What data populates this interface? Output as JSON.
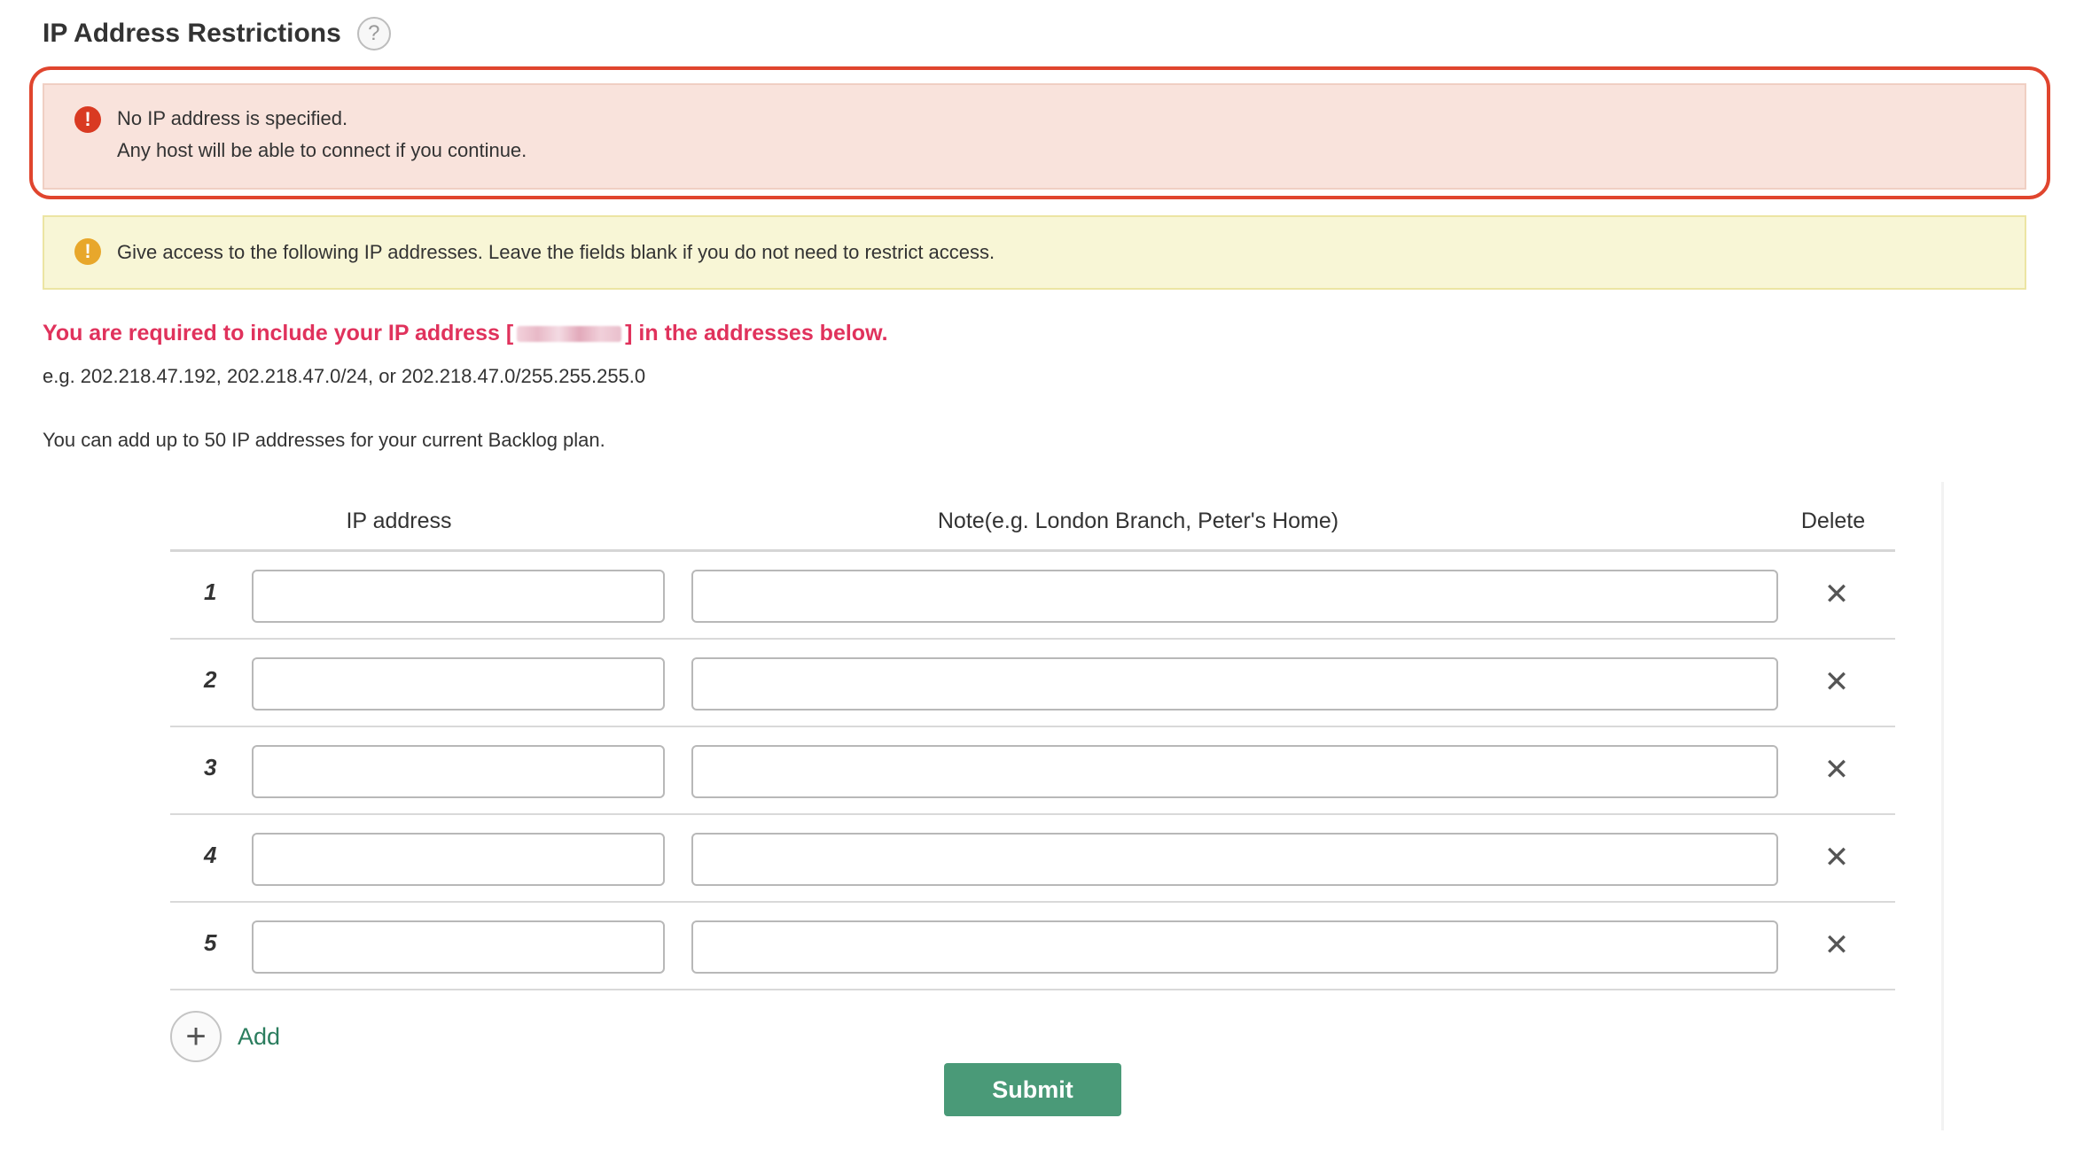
{
  "page": {
    "title": "IP Address Restrictions",
    "help_icon": "?"
  },
  "alerts": {
    "error": {
      "icon": "!",
      "line1": "No IP address is specified.",
      "line2": "Any host will be able to connect if you continue."
    },
    "warning": {
      "icon": "!",
      "text": "Give access to the following IP addresses. Leave the fields blank if you do not need to restrict access."
    }
  },
  "notice": {
    "required_prefix": "You are required to include your IP address [",
    "required_suffix": "] in the addresses below.",
    "example": "e.g. 202.218.47.192, 202.218.47.0/24, or 202.218.47.0/255.255.255.0",
    "limit": "You can add up to 50 IP addresses for your current Backlog plan."
  },
  "table": {
    "headers": {
      "ip": "IP address",
      "note": "Note(e.g. London Branch, Peter's Home)",
      "delete": "Delete"
    },
    "rows": [
      {
        "num": "1",
        "ip": "",
        "note": ""
      },
      {
        "num": "2",
        "ip": "",
        "note": ""
      },
      {
        "num": "3",
        "ip": "",
        "note": ""
      },
      {
        "num": "4",
        "ip": "",
        "note": ""
      },
      {
        "num": "5",
        "ip": "",
        "note": ""
      }
    ],
    "delete_glyph": "✕"
  },
  "actions": {
    "add_glyph": "+",
    "add_label": "Add",
    "submit_label": "Submit"
  },
  "colors": {
    "highlight": "#e0452e",
    "error_bg": "#f9e3dc",
    "warning_bg": "#f8f6d6",
    "required_text": "#e0325c",
    "submit_bg": "#4a9a78",
    "add_text": "#2b7d5e"
  }
}
